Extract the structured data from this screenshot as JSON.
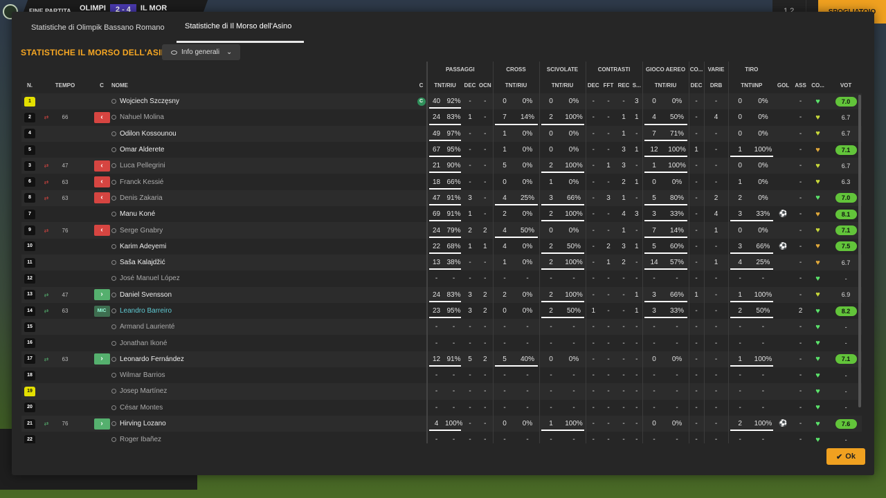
{
  "topbar": {
    "status": "FINE PARTITA",
    "home": "OLIMPI",
    "score": "2 - 4",
    "away": "IL MOR",
    "k_label": "1 2",
    "arrow": "⌄",
    "action": "SPOGLIATOIO"
  },
  "tabs": [
    {
      "label": "Statistiche di Olimpik Bassano Romano"
    },
    {
      "label": "Statistiche di Il Morso dell'Asino"
    }
  ],
  "title": "STATISTICHE IL MORSO DELL'ASINO",
  "dropdown": {
    "label": "Info generali"
  },
  "ok_label": "Ok",
  "groups": {
    "passaggi": "PASSAGGI",
    "cross": "CROSS",
    "scivolate": "SCIVOLATE",
    "contrasti": "CONTRASTI",
    "aereo": "GIOCO AEREO",
    "co": "CO...",
    "varie": "VARIE",
    "tiro": "TIRO"
  },
  "headers": {
    "n": "N.",
    "tempo": "TEMPO",
    "c": "C",
    "nome": "NOME",
    "c2": "C",
    "tnt_riu": "TNT/RIU",
    "dec": "DEC",
    "ocn": "OCN",
    "fft": "FFT",
    "rec": "REC",
    "s": "S...",
    "drb": "DRB",
    "tnt_inp": "TNT\\INP",
    "gol": "GOL",
    "ass": "ASS",
    "co": "CO...",
    "vot": "VOT"
  },
  "players": [
    {
      "n": "1",
      "gk": true,
      "sub": "",
      "min": "",
      "name": "Wojciech Szczęsny",
      "cap": true,
      "p": [
        "40",
        "92%"
      ],
      "pd": "-",
      "po": "-",
      "cr": [
        "0",
        "0%"
      ],
      "sc": [
        "0",
        "0%"
      ],
      "cd": "-",
      "cf": "-",
      "crc": "-",
      "cs": "3",
      "ae": [
        "0",
        "0%"
      ],
      "cod": "-",
      "drb": "-",
      "ti": [
        "0",
        "0%"
      ],
      "gol": "",
      "ass": "-",
      "heart": "g",
      "vot": "7.0",
      "vg": true
    },
    {
      "n": "2",
      "sub": "out",
      "min": "66",
      "name": "Nahuel Molina",
      "dim": true,
      "p": [
        "24",
        "83%"
      ],
      "pd": "1",
      "po": "-",
      "cr": [
        "7",
        "14%"
      ],
      "sc": [
        "2",
        "100%"
      ],
      "cd": "-",
      "cf": "-",
      "crc": "1",
      "cs": "1",
      "ae": [
        "4",
        "50%"
      ],
      "cod": "-",
      "drb": "4",
      "ti": [
        "0",
        "0%"
      ],
      "gol": "",
      "ass": "-",
      "heart": "y",
      "vot": "6.7"
    },
    {
      "n": "4",
      "sub": "",
      "min": "",
      "name": "Odilon Kossounou",
      "p": [
        "49",
        "97%"
      ],
      "pd": "-",
      "po": "-",
      "cr": [
        "1",
        "0%"
      ],
      "sc": [
        "0",
        "0%"
      ],
      "cd": "-",
      "cf": "-",
      "crc": "1",
      "cs": "-",
      "ae": [
        "7",
        "71%"
      ],
      "cod": "-",
      "drb": "-",
      "ti": [
        "0",
        "0%"
      ],
      "gol": "",
      "ass": "-",
      "heart": "y",
      "vot": "6.7"
    },
    {
      "n": "5",
      "sub": "",
      "min": "",
      "name": "Omar Alderete",
      "p": [
        "67",
        "95%"
      ],
      "pd": "-",
      "po": "-",
      "cr": [
        "1",
        "0%"
      ],
      "sc": [
        "0",
        "0%"
      ],
      "cd": "-",
      "cf": "-",
      "crc": "3",
      "cs": "1",
      "ae": [
        "12",
        "100%"
      ],
      "cod": "1",
      "drb": "-",
      "ti": [
        "1",
        "100%"
      ],
      "gol": "",
      "ass": "-",
      "heart": "o",
      "vot": "7.1",
      "vg": true
    },
    {
      "n": "3",
      "sub": "out",
      "min": "47",
      "name": "Luca Pellegrini",
      "dim": true,
      "p": [
        "21",
        "90%"
      ],
      "pd": "-",
      "po": "-",
      "cr": [
        "5",
        "0%"
      ],
      "sc": [
        "2",
        "100%"
      ],
      "cd": "-",
      "cf": "1",
      "crc": "3",
      "cs": "-",
      "ae": [
        "1",
        "100%"
      ],
      "cod": "-",
      "drb": "-",
      "ti": [
        "0",
        "0%"
      ],
      "gol": "",
      "ass": "-",
      "heart": "y",
      "vot": "6.7"
    },
    {
      "n": "6",
      "sub": "out",
      "min": "63",
      "name": "Franck Kessié",
      "dim": true,
      "p": [
        "18",
        "66%"
      ],
      "pd": "-",
      "po": "-",
      "cr": [
        "0",
        "0%"
      ],
      "sc": [
        "1",
        "0%"
      ],
      "cd": "-",
      "cf": "-",
      "crc": "2",
      "cs": "1",
      "ae": [
        "0",
        "0%"
      ],
      "cod": "-",
      "drb": "-",
      "ti": [
        "1",
        "0%"
      ],
      "gol": "",
      "ass": "-",
      "heart": "y",
      "vot": "6.3"
    },
    {
      "n": "8",
      "sub": "out",
      "min": "63",
      "name": "Denis Zakaria",
      "dim": true,
      "p": [
        "47",
        "91%"
      ],
      "pd": "3",
      "po": "-",
      "cr": [
        "4",
        "25%"
      ],
      "sc": [
        "3",
        "66%"
      ],
      "cd": "-",
      "cf": "3",
      "crc": "1",
      "cs": "-",
      "ae": [
        "5",
        "80%"
      ],
      "cod": "-",
      "drb": "2",
      "ti": [
        "2",
        "0%"
      ],
      "gol": "",
      "ass": "-",
      "heart": "g",
      "vot": "7.0",
      "vg": true
    },
    {
      "n": "7",
      "sub": "",
      "min": "",
      "name": "Manu Koné",
      "p": [
        "69",
        "91%"
      ],
      "pd": "1",
      "po": "-",
      "cr": [
        "2",
        "0%"
      ],
      "sc": [
        "2",
        "100%"
      ],
      "cd": "-",
      "cf": "-",
      "crc": "4",
      "cs": "3",
      "ae": [
        "3",
        "33%"
      ],
      "cod": "-",
      "drb": "4",
      "ti": [
        "3",
        "33%"
      ],
      "gol": "ball",
      "ass": "-",
      "heart": "o",
      "vot": "8.1",
      "vg": true
    },
    {
      "n": "9",
      "sub": "out",
      "min": "76",
      "name": "Serge Gnabry",
      "dim": true,
      "p": [
        "24",
        "79%"
      ],
      "pd": "2",
      "po": "2",
      "cr": [
        "4",
        "50%"
      ],
      "sc": [
        "0",
        "0%"
      ],
      "cd": "-",
      "cf": "-",
      "crc": "1",
      "cs": "-",
      "ae": [
        "7",
        "14%"
      ],
      "cod": "-",
      "drb": "1",
      "ti": [
        "0",
        "0%"
      ],
      "gol": "",
      "ass": "-",
      "heart": "y",
      "vot": "7.1",
      "vg": true
    },
    {
      "n": "10",
      "sub": "",
      "min": "",
      "name": "Karim Adeyemi",
      "p": [
        "22",
        "68%"
      ],
      "pd": "1",
      "po": "1",
      "cr": [
        "4",
        "0%"
      ],
      "sc": [
        "2",
        "50%"
      ],
      "cd": "-",
      "cf": "2",
      "crc": "3",
      "cs": "1",
      "ae": [
        "5",
        "60%"
      ],
      "cod": "-",
      "drb": "-",
      "ti": [
        "3",
        "66%"
      ],
      "gol": "ball",
      "ass": "-",
      "heart": "o",
      "vot": "7.5",
      "vg": true
    },
    {
      "n": "11",
      "sub": "",
      "min": "",
      "name": "Saša Kalajdžić",
      "p": [
        "13",
        "38%"
      ],
      "pd": "-",
      "po": "-",
      "cr": [
        "1",
        "0%"
      ],
      "sc": [
        "2",
        "100%"
      ],
      "cd": "-",
      "cf": "1",
      "crc": "2",
      "cs": "-",
      "ae": [
        "14",
        "57%"
      ],
      "cod": "-",
      "drb": "1",
      "ti": [
        "4",
        "25%"
      ],
      "gol": "",
      "ass": "-",
      "heart": "o",
      "vot": "6.7"
    },
    {
      "n": "12",
      "sub": "",
      "min": "",
      "name": "José Manuel López",
      "dim": true,
      "empty": true,
      "heart": "g",
      "vot": "-"
    },
    {
      "n": "13",
      "sub": "in",
      "min": "47",
      "name": "Daniel Svensson",
      "p": [
        "24",
        "83%"
      ],
      "pd": "3",
      "po": "2",
      "cr": [
        "2",
        "0%"
      ],
      "sc": [
        "2",
        "100%"
      ],
      "cd": "-",
      "cf": "-",
      "crc": "-",
      "cs": "1",
      "ae": [
        "3",
        "66%"
      ],
      "cod": "1",
      "drb": "-",
      "ti": [
        "1",
        "100%"
      ],
      "gol": "",
      "ass": "-",
      "heart": "y",
      "vot": "6.9"
    },
    {
      "n": "14",
      "sub": "mic",
      "min": "63",
      "name": "Leandro Barreiro",
      "hl": true,
      "p": [
        "23",
        "95%"
      ],
      "pd": "3",
      "po": "2",
      "cr": [
        "0",
        "0%"
      ],
      "sc": [
        "2",
        "50%"
      ],
      "cd": "1",
      "cf": "-",
      "crc": "-",
      "cs": "1",
      "ae": [
        "3",
        "33%"
      ],
      "cod": "-",
      "drb": "-",
      "ti": [
        "2",
        "50%"
      ],
      "gol": "",
      "ass": "2",
      "heart": "g",
      "vot": "8.2",
      "vg": true
    },
    {
      "n": "15",
      "sub": "",
      "min": "",
      "name": "Armand Laurienté",
      "dim": true,
      "empty": true,
      "heart": "g",
      "vot": "-"
    },
    {
      "n": "16",
      "sub": "",
      "min": "",
      "name": "Jonathan Ikoné",
      "dim": true,
      "empty": true,
      "heart": "g",
      "vot": "-"
    },
    {
      "n": "17",
      "sub": "in",
      "min": "63",
      "name": "Leonardo Fernández",
      "p": [
        "12",
        "91%"
      ],
      "pd": "5",
      "po": "2",
      "cr": [
        "5",
        "40%"
      ],
      "sc": [
        "0",
        "0%"
      ],
      "cd": "-",
      "cf": "-",
      "crc": "-",
      "cs": "-",
      "ae": [
        "0",
        "0%"
      ],
      "cod": "-",
      "drb": "-",
      "ti": [
        "1",
        "100%"
      ],
      "gol": "",
      "ass": "-",
      "heart": "g",
      "vot": "7.1",
      "vg": true
    },
    {
      "n": "18",
      "sub": "",
      "min": "",
      "name": "Wilmar Barrios",
      "dim": true,
      "empty": true,
      "heart": "g",
      "vot": "-"
    },
    {
      "n": "19",
      "gk": true,
      "sub": "",
      "min": "",
      "name": "Josep Martínez",
      "dim": true,
      "empty": true,
      "heart": "g",
      "vot": "-"
    },
    {
      "n": "20",
      "sub": "",
      "min": "",
      "name": "César Montes",
      "dim": true,
      "empty": true,
      "heart": "g",
      "vot": "-"
    },
    {
      "n": "21",
      "sub": "in",
      "min": "76",
      "name": "Hirving Lozano",
      "p": [
        "4",
        "100%"
      ],
      "pd": "-",
      "po": "-",
      "cr": [
        "0",
        "0%"
      ],
      "sc": [
        "1",
        "100%"
      ],
      "cd": "-",
      "cf": "-",
      "crc": "-",
      "cs": "-",
      "ae": [
        "0",
        "0%"
      ],
      "cod": "-",
      "drb": "-",
      "ti": [
        "2",
        "100%"
      ],
      "gol": "ball",
      "ass": "-",
      "heart": "g",
      "vot": "7.6",
      "vg": true
    },
    {
      "n": "22",
      "sub": "",
      "min": "",
      "name": "Roger Ibañez",
      "dim": true,
      "empty": true,
      "heart": "g",
      "vot": "-"
    }
  ]
}
